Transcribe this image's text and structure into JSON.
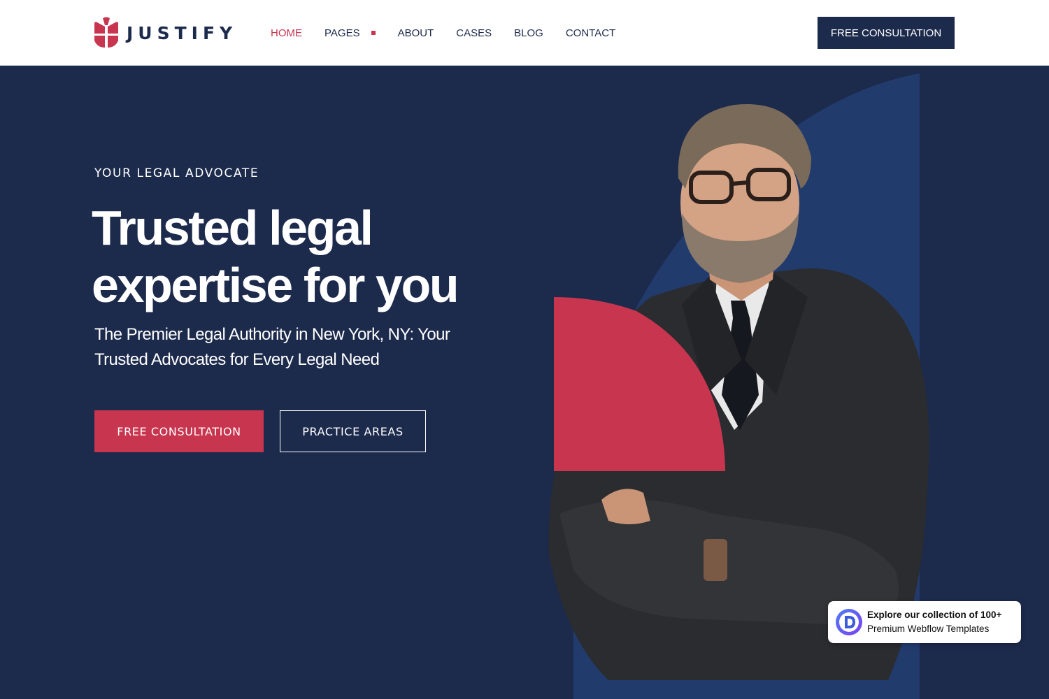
{
  "brand": {
    "name": "JUSTIFY",
    "logo_icon": "justify-logo-icon"
  },
  "nav": {
    "items": [
      {
        "label": "HOME",
        "active": true
      },
      {
        "label": "PAGES",
        "has_dropdown": true
      },
      {
        "label": "ABOUT"
      },
      {
        "label": "CASES"
      },
      {
        "label": "BLOG"
      },
      {
        "label": "CONTACT"
      }
    ],
    "cta_label": "FREE CONSULTATION"
  },
  "hero": {
    "eyebrow": "YOUR LEGAL ADVOCATE",
    "headline_line1": "Trusted legal",
    "headline_line2": "expertise for you",
    "subhead": "The Premier Legal Authority in New York, NY: Your Trusted Advocates for Every Legal Need",
    "primary_button": "FREE CONSULTATION",
    "secondary_button": "PRACTICE AREAS",
    "image": "attorney-portrait"
  },
  "badge": {
    "line1": "Explore our collection of 100+",
    "line2": "Premium Webflow Templates",
    "icon": "designer-d-icon"
  },
  "colors": {
    "navy": "#1c2a4c",
    "accent_red": "#c8354f",
    "arch_blue": "#223b6d",
    "white": "#ffffff"
  }
}
